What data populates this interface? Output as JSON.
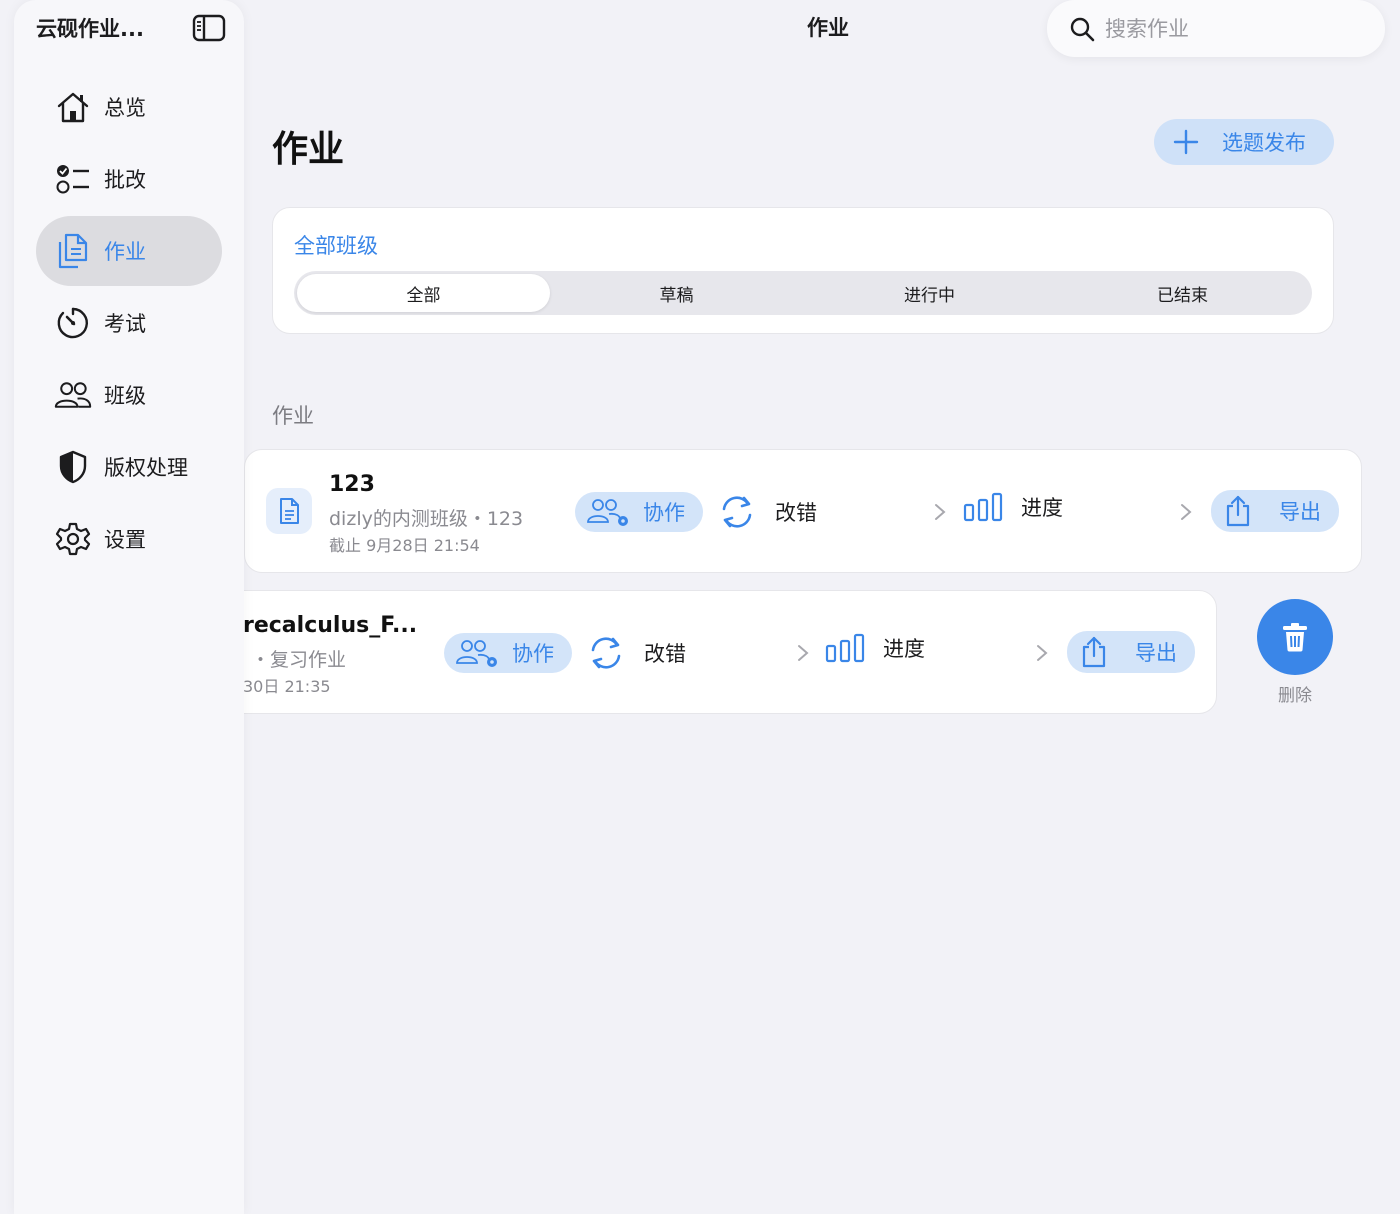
{
  "sidebar": {
    "title": "云砚作业...",
    "items": [
      {
        "label": "总览",
        "icon": "house-icon"
      },
      {
        "label": "批改",
        "icon": "checklist-icon"
      },
      {
        "label": "作业",
        "icon": "documents-icon"
      },
      {
        "label": "考试",
        "icon": "timer-icon"
      },
      {
        "label": "班级",
        "icon": "people-icon"
      },
      {
        "label": "版权处理",
        "icon": "shield-icon"
      },
      {
        "label": "设置",
        "icon": "gear-icon"
      }
    ],
    "active_index": 2
  },
  "topbar": {
    "title": "作业",
    "search_placeholder": "搜索作业"
  },
  "main": {
    "title": "作业",
    "publish_label": "选题发布",
    "filter": {
      "class_link": "全部班级",
      "segments": [
        "全部",
        "草稿",
        "进行中",
        "已结束"
      ],
      "active_segment": 0
    },
    "section_label": "作业",
    "rows": [
      {
        "title": "123",
        "subtitle": "dizly的内测班级・123",
        "due": "截止 9月28日 21:54",
        "collab_label": "协作",
        "correct_label": "改错",
        "progress_label": "进度",
        "export_label": "导出"
      },
      {
        "title": "recalculus_F...",
        "subtitle": "・复习作业",
        "due": "30日 21:35",
        "collab_label": "协作",
        "correct_label": "改错",
        "progress_label": "进度",
        "export_label": "导出"
      }
    ],
    "delete_label": "删除"
  },
  "colors": {
    "accent": "#3a86e8",
    "accent_soft": "#d3e4f9",
    "background": "#f2f2f7"
  }
}
